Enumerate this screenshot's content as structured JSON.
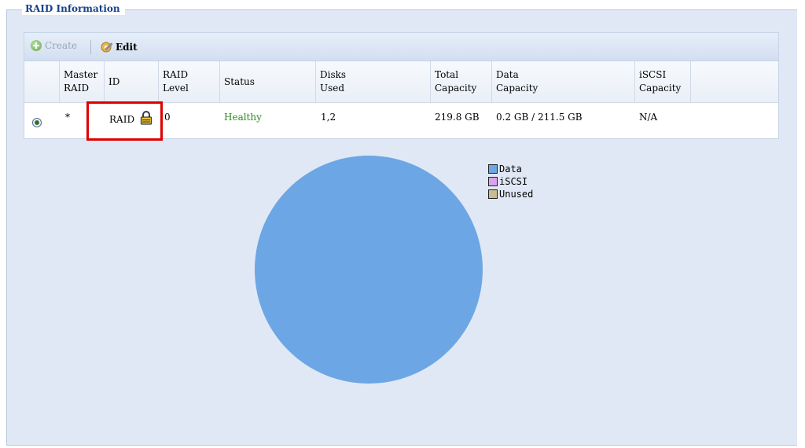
{
  "panel": {
    "title": "RAID Information"
  },
  "toolbar": {
    "create_label": "Create",
    "edit_label": "Edit"
  },
  "table": {
    "headers": [
      {
        "line1": "Master",
        "line2": "RAID"
      },
      {
        "line1": "ID",
        "line2": ""
      },
      {
        "line1": "RAID",
        "line2": "Level"
      },
      {
        "line1": "Status",
        "line2": ""
      },
      {
        "line1": "Disks",
        "line2": "Used"
      },
      {
        "line1": "Total",
        "line2": "Capacity"
      },
      {
        "line1": "Data",
        "line2": "Capacity"
      },
      {
        "line1": "iSCSI",
        "line2": "Capacity"
      }
    ],
    "rows": [
      {
        "selected": true,
        "master": "*",
        "id": "RAID",
        "level": "0",
        "status": "Healthy",
        "disks": "1,2",
        "total": "219.8 GB",
        "data": "0.2 GB / 211.5 GB",
        "iscsi": "N/A"
      }
    ]
  },
  "chart": {
    "legend": [
      "Data",
      "iSCSI",
      "Unused"
    ],
    "colors": {
      "Data": "#6ca6e4",
      "iSCSI": "#d9a3f0",
      "Unused": "#c8bd8f"
    }
  },
  "colors": {
    "status_healthy": "#2e8b1f",
    "highlight": "#e00000"
  }
}
